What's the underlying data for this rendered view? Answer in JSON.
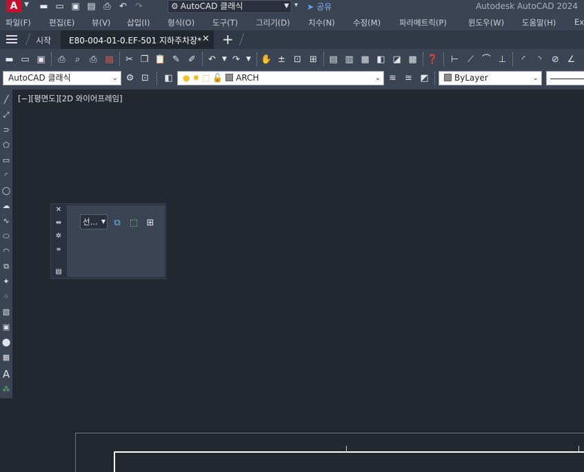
{
  "titlebar": {
    "logo": "A",
    "workspace": "AutoCAD 클래식",
    "share": "공유",
    "app_title": "Autodesk AutoCAD 2024"
  },
  "menu": [
    "파일(F)",
    "편집(E)",
    "뷰(V)",
    "삽입(I)",
    "형식(O)",
    "도구(T)",
    "그리기(D)",
    "치수(N)",
    "수정(M)",
    "파라메트릭(P)",
    "윈도우(W)",
    "도움말(H)",
    "Ex"
  ],
  "tabs": {
    "start": "시작",
    "active": "E80-004-01-0.EF-501 지하주차장*"
  },
  "toolbar2": {
    "workspace_combo": "AutoCAD 클래식",
    "layer_combo": "ARCH",
    "color_combo": "ByLayer"
  },
  "viewport": {
    "label": "[−][평면도][2D 와이어프레임]"
  },
  "palette": {
    "select_label": "선..."
  },
  "colors": {
    "background": "#212830",
    "chrome": "#3b4453",
    "logo": "#c8102e",
    "share": "#7ab8ff"
  }
}
